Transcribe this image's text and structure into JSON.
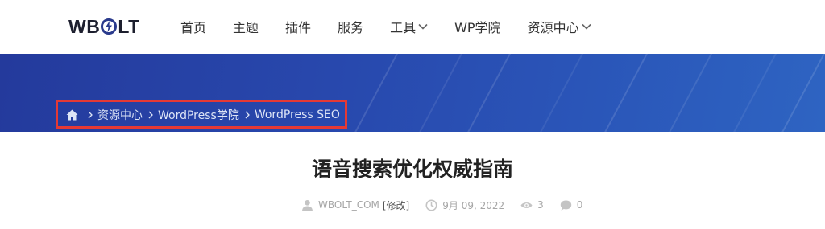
{
  "header": {
    "logo_text_left": "WB",
    "logo_text_right": "LT",
    "nav": [
      {
        "label": "首页",
        "has_dropdown": false
      },
      {
        "label": "主题",
        "has_dropdown": false
      },
      {
        "label": "插件",
        "has_dropdown": false
      },
      {
        "label": "服务",
        "has_dropdown": false
      },
      {
        "label": "工具",
        "has_dropdown": true
      },
      {
        "label": "WP学院",
        "has_dropdown": false
      },
      {
        "label": "资源中心",
        "has_dropdown": true
      }
    ]
  },
  "breadcrumb": {
    "items": [
      "资源中心",
      "WordPress学院",
      "WordPress SEO"
    ],
    "highlight_color": "#e53935"
  },
  "article": {
    "title": "语音搜索优化权威指南",
    "author": "WBOLT_COM",
    "edit_label": "[修改]",
    "date": "9月 09, 2022",
    "views": "3",
    "comments": "0"
  },
  "colors": {
    "hero_start": "#243a9c",
    "hero_end": "#2e64c2",
    "logo_accent": "#2a3a8c"
  }
}
